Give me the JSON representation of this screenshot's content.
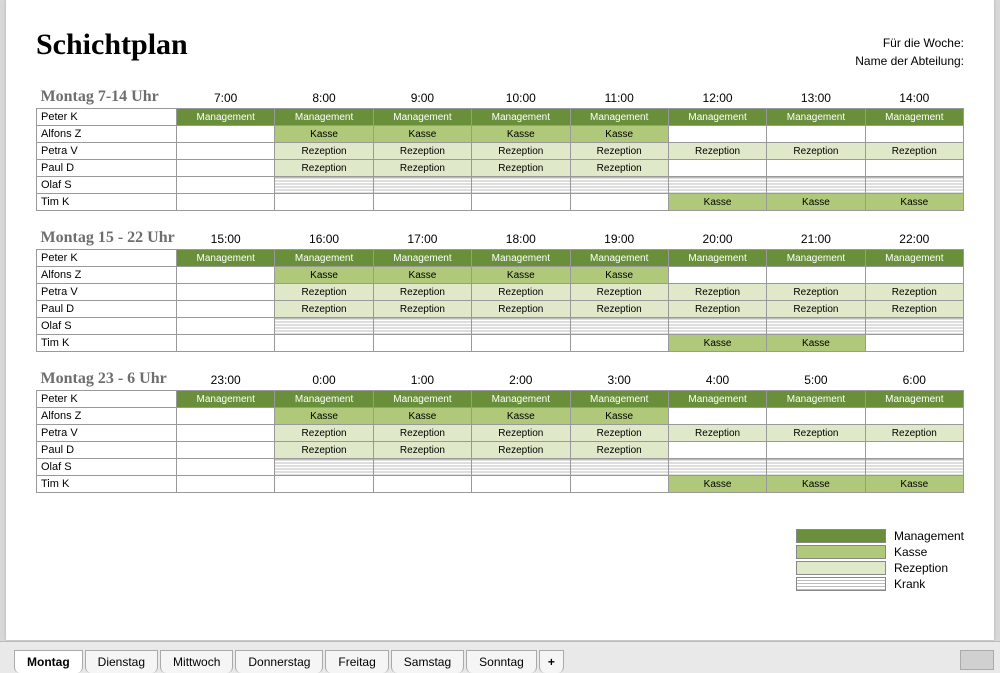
{
  "header": {
    "title": "Schichtplan",
    "meta1": "Für die Woche:",
    "meta2": "Name der Abteilung:"
  },
  "roles": {
    "management": "Management",
    "kasse": "Kasse",
    "rezeption": "Rezeption",
    "krank": "Krank"
  },
  "blocks": [
    {
      "title": "Montag 7-14 Uhr",
      "times": [
        "7:00",
        "8:00",
        "9:00",
        "10:00",
        "11:00",
        "12:00",
        "13:00",
        "14:00"
      ],
      "rows": [
        {
          "name": "Peter K",
          "cells": [
            "management",
            "management",
            "management",
            "management",
            "management",
            "management",
            "management",
            "management"
          ]
        },
        {
          "name": "Alfons Z",
          "cells": [
            "empty",
            "kasse",
            "kasse",
            "kasse",
            "kasse",
            "empty",
            "empty",
            "empty"
          ]
        },
        {
          "name": "Petra V",
          "cells": [
            "empty",
            "rezeption",
            "rezeption",
            "rezeption",
            "rezeption",
            "rezeption",
            "rezeption",
            "rezeption"
          ]
        },
        {
          "name": "Paul D",
          "cells": [
            "empty",
            "rezeption",
            "rezeption",
            "rezeption",
            "rezeption",
            "empty",
            "empty",
            "empty"
          ]
        },
        {
          "name": "Olaf S",
          "cells": [
            "empty",
            "krank",
            "krank",
            "krank",
            "krank",
            "krank",
            "krank",
            "krank"
          ]
        },
        {
          "name": "Tim K",
          "cells": [
            "empty",
            "empty",
            "empty",
            "empty",
            "empty",
            "kasse",
            "kasse",
            "kasse"
          ]
        }
      ]
    },
    {
      "title": "Montag 15 - 22 Uhr",
      "times": [
        "15:00",
        "16:00",
        "17:00",
        "18:00",
        "19:00",
        "20:00",
        "21:00",
        "22:00"
      ],
      "rows": [
        {
          "name": "Peter K",
          "cells": [
            "management",
            "management",
            "management",
            "management",
            "management",
            "management",
            "management",
            "management"
          ]
        },
        {
          "name": "Alfons Z",
          "cells": [
            "empty",
            "kasse",
            "kasse",
            "kasse",
            "kasse",
            "empty",
            "empty",
            "empty"
          ]
        },
        {
          "name": "Petra V",
          "cells": [
            "empty",
            "rezeption",
            "rezeption",
            "rezeption",
            "rezeption",
            "rezeption",
            "rezeption",
            "rezeption"
          ]
        },
        {
          "name": "Paul D",
          "cells": [
            "empty",
            "rezeption",
            "rezeption",
            "rezeption",
            "rezeption",
            "rezeption",
            "rezeption",
            "rezeption"
          ]
        },
        {
          "name": "Olaf S",
          "cells": [
            "empty",
            "krank",
            "krank",
            "krank",
            "krank",
            "krank",
            "krank",
            "krank"
          ]
        },
        {
          "name": "Tim K",
          "cells": [
            "empty",
            "empty",
            "empty",
            "empty",
            "empty",
            "kasse",
            "kasse",
            "empty"
          ]
        }
      ]
    },
    {
      "title": "Montag 23 - 6 Uhr",
      "times": [
        "23:00",
        "0:00",
        "1:00",
        "2:00",
        "3:00",
        "4:00",
        "5:00",
        "6:00"
      ],
      "rows": [
        {
          "name": "Peter K",
          "cells": [
            "management",
            "management",
            "management",
            "management",
            "management",
            "management",
            "management",
            "management"
          ]
        },
        {
          "name": "Alfons Z",
          "cells": [
            "empty",
            "kasse",
            "kasse",
            "kasse",
            "kasse",
            "empty",
            "empty",
            "empty"
          ]
        },
        {
          "name": "Petra V",
          "cells": [
            "empty",
            "rezeption",
            "rezeption",
            "rezeption",
            "rezeption",
            "rezeption",
            "rezeption",
            "rezeption"
          ]
        },
        {
          "name": "Paul D",
          "cells": [
            "empty",
            "rezeption",
            "rezeption",
            "rezeption",
            "rezeption",
            "empty",
            "empty",
            "empty"
          ]
        },
        {
          "name": "Olaf S",
          "cells": [
            "empty",
            "krank",
            "krank",
            "krank",
            "krank",
            "krank",
            "krank",
            "krank"
          ]
        },
        {
          "name": "Tim K",
          "cells": [
            "empty",
            "empty",
            "empty",
            "empty",
            "empty",
            "kasse",
            "kasse",
            "kasse"
          ]
        }
      ]
    }
  ],
  "legend": [
    {
      "role": "management",
      "label": "Management"
    },
    {
      "role": "kasse",
      "label": "Kasse"
    },
    {
      "role": "rezeption",
      "label": "Rezeption"
    },
    {
      "role": "krank",
      "label": "Krank"
    }
  ],
  "tabs": {
    "items": [
      "Montag",
      "Dienstag",
      "Mittwoch",
      "Donnerstag",
      "Freitag",
      "Samstag",
      "Sonntag"
    ],
    "active": 0,
    "add": "+"
  }
}
